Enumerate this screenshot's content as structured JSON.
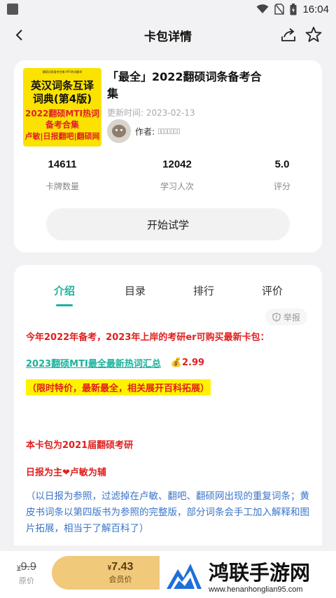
{
  "status_bar": {
    "time": "16:04"
  },
  "navbar": {
    "title": "卡包详情"
  },
  "pack": {
    "title": "「最全」2022翻硕词条备考合集",
    "updated": "更新时间: 2023-02-13",
    "author_label": "作者:",
    "author_name": "▯▯▯▯▯▯▯",
    "cover": {
      "top_text": "翻硕词条备考合集 MTI热词翻译",
      "line1": "英汉词条互译",
      "line2": "词典(第4版)",
      "line3": "2022翻硕MTI热词",
      "line4": "备考合集",
      "line5": "卢敏|日报翻吧|翻硕网"
    }
  },
  "stats": [
    {
      "value": "14611",
      "label": "卡牌数量"
    },
    {
      "value": "12042",
      "label": "学习人次"
    },
    {
      "value": "5.0",
      "label": "评分"
    }
  ],
  "try_button": "开始试学",
  "tabs": [
    "介绍",
    "目录",
    "排行",
    "评价"
  ],
  "active_tab": "介绍",
  "report_label": "举报",
  "intro": {
    "line1": "今年2022年备考，2023年上岸的考研er可购买最新卡包：",
    "link": "2023翻硕MTI最全最新热词汇总",
    "link_price": "💰2.99",
    "highlight": "（限时特价，最新最全，相关展开百科拓展）",
    "line4": "本卡包为2021届翻硕考研",
    "line5_a": "日报为主",
    "line5_heart": "❤",
    "line5_b": "卢敏为辅",
    "paragraph": "（以日报为参照，过滤掉在卢敏、翻吧、翻硕网出现的重复词条；黄皮书词条以第四版书为参照的完整版，部分词条会手工加入解释和图片拓展，相当于了解百科了）"
  },
  "bottom": {
    "orig_currency": "¥",
    "orig_price": "9.9",
    "orig_label": "原价",
    "member_currency": "¥",
    "member_price": "7.43",
    "member_label": "会员价"
  },
  "watermark": {
    "main": "鸿联手游网",
    "url": "www.henanhonglian95.com"
  },
  "colors": {
    "accent": "#1bb39c",
    "red_text": "#e01f1f",
    "blue_text": "#3a74c9",
    "member_button": "#f1c97a",
    "cover_yellow": "#fbe200"
  }
}
